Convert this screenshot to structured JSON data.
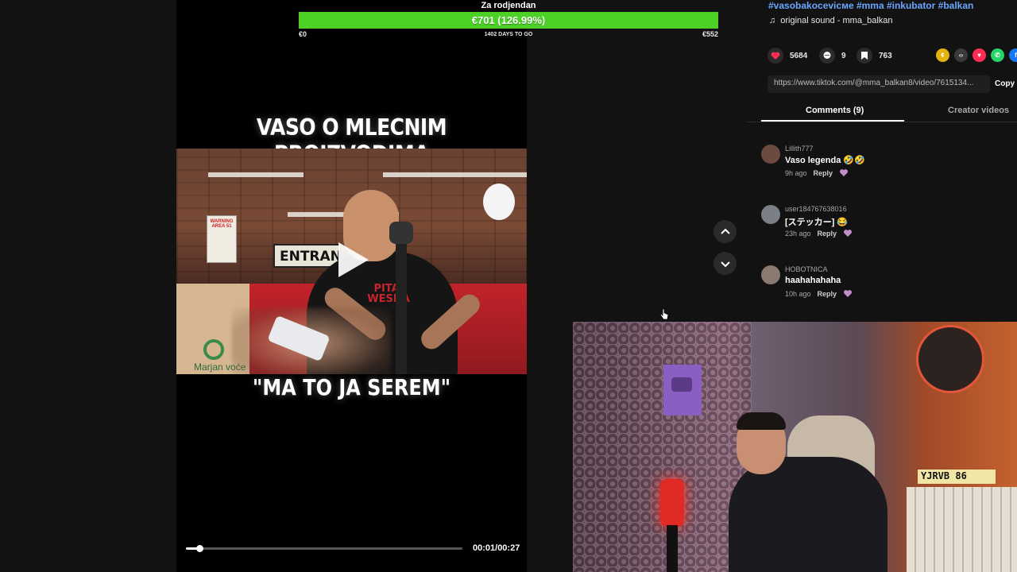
{
  "goal": {
    "title": "Za rodjendan",
    "amount_label": "€701 (126.99%)",
    "start_label": "€0",
    "to_go_label": "1402 DAYS TO GO",
    "end_label": "€552",
    "progress_fraction": 1.0,
    "fill_color": "#4cd227"
  },
  "video": {
    "title_text": "VASO O MLECNIM PROIZVODIMA",
    "caption_text": "\"MA TO JA SEREM\"",
    "frame_sign_entrance": "ENTRANC",
    "frame_warning_sign": "WARNING AREA 51",
    "frame_shirt_print": "PITAJ WESNA",
    "frame_bag_text": "Marjan voće",
    "time_label": "00:01/00:27",
    "progress_fraction": 0.05,
    "play_icon": "play-icon"
  },
  "navigation": {
    "up_icon": "chevron-up-icon",
    "down_icon": "chevron-down-icon"
  },
  "post": {
    "hashtags": "#vasobakocevicмe #mma #inkubator #balkan",
    "music_icon": "music-note-icon",
    "music_label": "original sound - mma_balkan",
    "likes": "5684",
    "comments_count": "9",
    "saves": "763",
    "link_url": "https://www.tiktok.com/@mma_balkan8/video/7615134...",
    "copy_label": "Copy",
    "share_icons": [
      "coin-icon",
      "embed-icon",
      "send-icon",
      "whatsapp-icon",
      "facebook-icon"
    ],
    "like_color": "#fe2c55"
  },
  "tabs": {
    "comments_label": "Comments (9)",
    "creator_label": "Creator videos"
  },
  "comments": [
    {
      "user": "Lillith777",
      "text": "Vaso legenda 🤣🤣",
      "time": "9h ago",
      "reply": "Reply"
    },
    {
      "user": "user184767638016",
      "text": "[ステッカー] 😂",
      "time": "23h ago",
      "reply": "Reply"
    },
    {
      "user": "HOBOTNICA",
      "text": "haahahahaha",
      "time": "10h ago",
      "reply": "Reply"
    }
  ],
  "webcam": {
    "plate_text": "YJRVB 86"
  }
}
